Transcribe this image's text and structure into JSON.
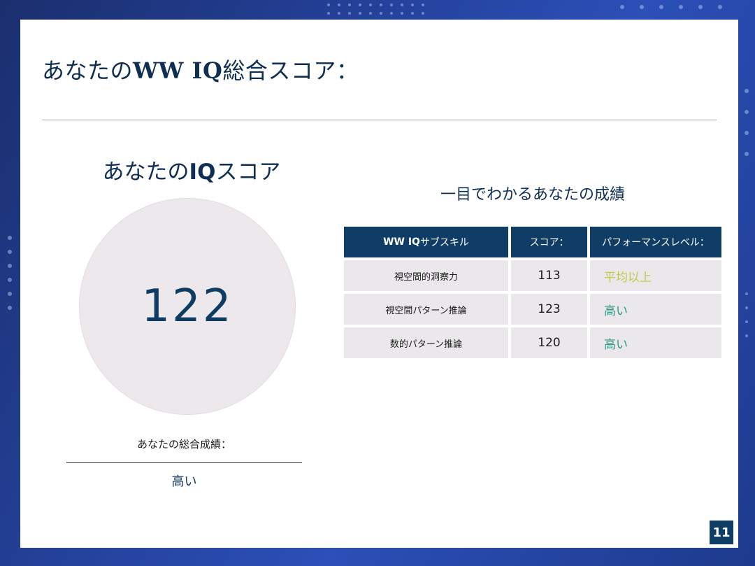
{
  "slide": {
    "title_prefix": "あなたの",
    "title_bold": "WW IQ",
    "title_suffix": "総合スコア：",
    "page_number": "11"
  },
  "iq_panel": {
    "title_prefix": "あなたの",
    "title_bold": "IQ",
    "title_suffix": "スコア",
    "score": "122",
    "overall_label": "あなたの総合成績：",
    "overall_value": "高い"
  },
  "glance": {
    "title": "一目でわかるあなたの成績",
    "headers": {
      "skill_bold": "WW IQ",
      "skill_suffix": "サブスキル",
      "score": "スコア：",
      "level": "パフォーマンスレベル："
    },
    "rows": [
      {
        "skill": "視空間的洞察力",
        "score": "113",
        "level": "平均以上",
        "level_color": "#c2c94a"
      },
      {
        "skill": "視空間パターン推論",
        "score": "123",
        "level": "高い",
        "level_color": "#2a9a86"
      },
      {
        "skill": "数的パターン推論",
        "score": "120",
        "level": "高い",
        "level_color": "#2a9a86"
      }
    ]
  },
  "colors": {
    "navy": "#0f3d66",
    "background_blue": "#24419a",
    "cell_gray": "#ebe8eb"
  }
}
